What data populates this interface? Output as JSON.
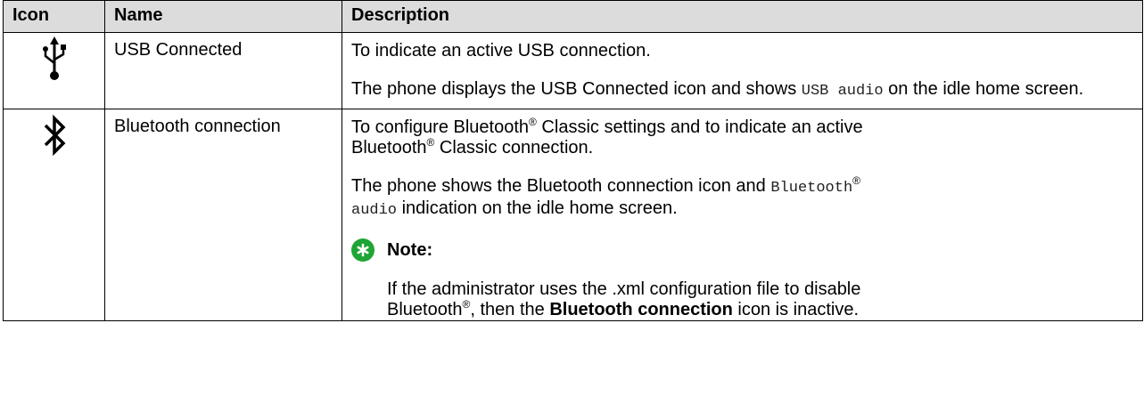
{
  "table": {
    "headers": [
      "Icon",
      "Name",
      "Description"
    ],
    "usb": {
      "icon": "usb-icon",
      "name": "USB Connected",
      "desc1": "To indicate an active USB connection.",
      "desc2_a": "The phone displays the USB Connected icon and shows ",
      "desc2_code": "USB audio",
      "desc2_b": " on the idle home screen."
    },
    "bluetooth": {
      "icon": "bluetooth-icon",
      "name": "Bluetooth connection",
      "desc1_a": "To configure Bluetooth",
      "desc1_b": " Classic settings and to indicate an active",
      "desc1_c": "Bluetooth",
      "desc1_d": " Classic connection.",
      "desc2_a": "The phone shows the Bluetooth connection icon and ",
      "desc2_code1": "Bluetooth",
      "desc2_code2": "audio",
      "desc2_b": " indication on the idle home screen.",
      "note_title": "Note:",
      "note_a": "If the administrator uses the .xml configuration file to disable",
      "note_b": "Bluetooth",
      "note_c": ", then the ",
      "note_bold": "Bluetooth connection",
      "note_d": " icon is inactive.",
      "reg": "®"
    }
  },
  "colors": {
    "header_bg": "#dcdcdc",
    "note_icon": "#1ea535"
  }
}
